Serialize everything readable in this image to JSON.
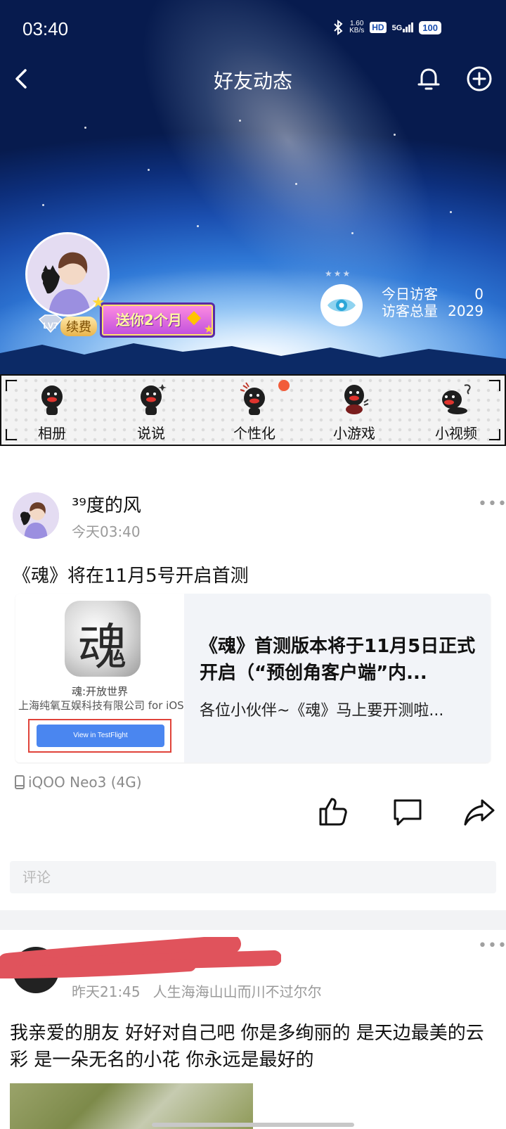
{
  "status": {
    "time": "03:40",
    "net_speed_value": "1.60",
    "net_speed_unit": "KB/s",
    "hd": "HD",
    "signal": "5G",
    "battery": "100"
  },
  "nav": {
    "title": "好友动态"
  },
  "profile": {
    "level": "LV7",
    "renew_label": "续费",
    "gift_banner": "送你2个月"
  },
  "visitors": {
    "today_label": "今日访客",
    "today_count": "0",
    "total_label": "访客总量",
    "total_count": "2029"
  },
  "quick_menu": [
    {
      "label": "相册",
      "icon": "mascot-album-icon"
    },
    {
      "label": "说说",
      "icon": "mascot-moments-icon"
    },
    {
      "label": "个性化",
      "icon": "mascot-personalize-icon",
      "has_dot": true
    },
    {
      "label": "小游戏",
      "icon": "mascot-game-icon"
    },
    {
      "label": "小视频",
      "icon": "mascot-video-icon"
    }
  ],
  "post1": {
    "author": "³⁹度的风",
    "time": "今天03:40",
    "text": "《魂》将在11月5号开启首测",
    "card": {
      "app_icon_char": "魂",
      "thumb_title": "魂:开放世界",
      "thumb_subtitle": "上海纯氧互娱科技有限公司 for iOS",
      "testflight_button": "View in TestFlight",
      "title": "《魂》首测版本将于11月5日正式开启（“预创角客户端”内...",
      "description": "各位小伙伴~《魂》马上要开测啦..."
    },
    "device": "iQOO Neo3 (4G)",
    "comment_placeholder": "评论"
  },
  "post2": {
    "time": "昨天21:45",
    "signature": "人生海海山山而川不过尔尔",
    "text": "我亲爱的朋友 好好对自己吧  你是多绚丽的 是天边最美的云彩 是一朵无名的小花 你永远是最好的"
  },
  "colors": {
    "accent_blue": "#4a86f0",
    "notification_dot": "#f25c3a",
    "redaction": "#e0535c"
  }
}
